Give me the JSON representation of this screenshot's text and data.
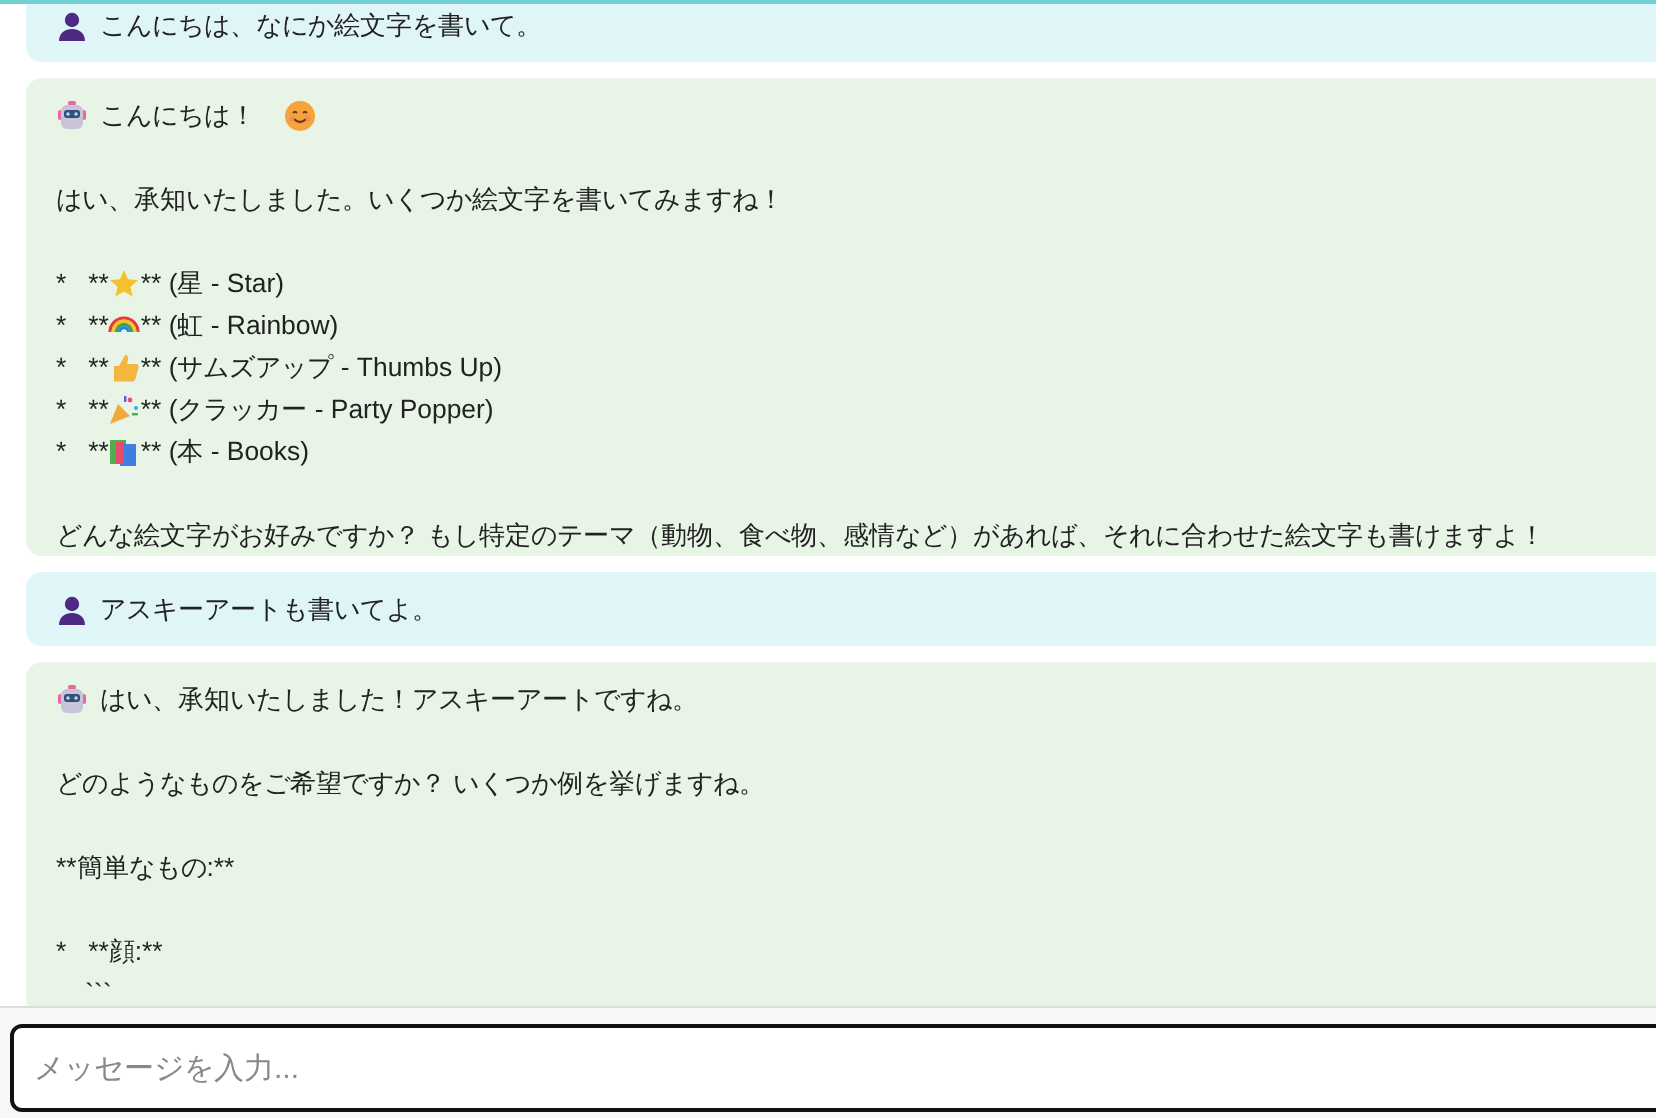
{
  "messages": [
    {
      "kind": "user",
      "text": "こんにちは、なにか絵文字を書いて。"
    },
    {
      "kind": "bot",
      "blocks": [
        {
          "kind": "lead",
          "text": "こんにちは！",
          "emoji": {
            "kind": "smile"
          }
        },
        {
          "kind": "text",
          "text": "はい、承知いたしました。いくつか絵文字を書いてみますね！"
        },
        {
          "kind": "list",
          "items": [
            {
              "kind": "star",
              "prefix": "*   **",
              "label": "** (星 - Star)"
            },
            {
              "kind": "rainbow",
              "prefix": "*   **",
              "label": "** (虹 - Rainbow)"
            },
            {
              "kind": "thumbs",
              "prefix": "*   **",
              "label": "** (サムズアップ - Thumbs Up)"
            },
            {
              "kind": "popper",
              "prefix": "*   **",
              "label": "** (クラッカー - Party Popper)"
            },
            {
              "kind": "books",
              "prefix": "*   **",
              "label": "** (本 - Books)"
            }
          ]
        },
        {
          "kind": "text",
          "text": "どんな絵文字がお好みですか？ もし特定のテーマ（動物、食べ物、感情など）があれば、それに合わせた絵文字も書けますよ！"
        }
      ]
    },
    {
      "kind": "user",
      "text": "アスキーアートも書いてよ。"
    },
    {
      "kind": "bot",
      "blocks": [
        {
          "kind": "lead",
          "text": "はい、承知いたしました！アスキーアートですね。"
        },
        {
          "kind": "text",
          "text": "どのようなものをご希望ですか？ いくつか例を挙げますね。"
        },
        {
          "kind": "text",
          "text": "**簡単なもの:**"
        },
        {
          "kind": "lines",
          "lines": [
            "*   **顔:**",
            "    ```"
          ]
        }
      ]
    }
  ],
  "composer": {
    "placeholder": "メッセージを入力..."
  }
}
